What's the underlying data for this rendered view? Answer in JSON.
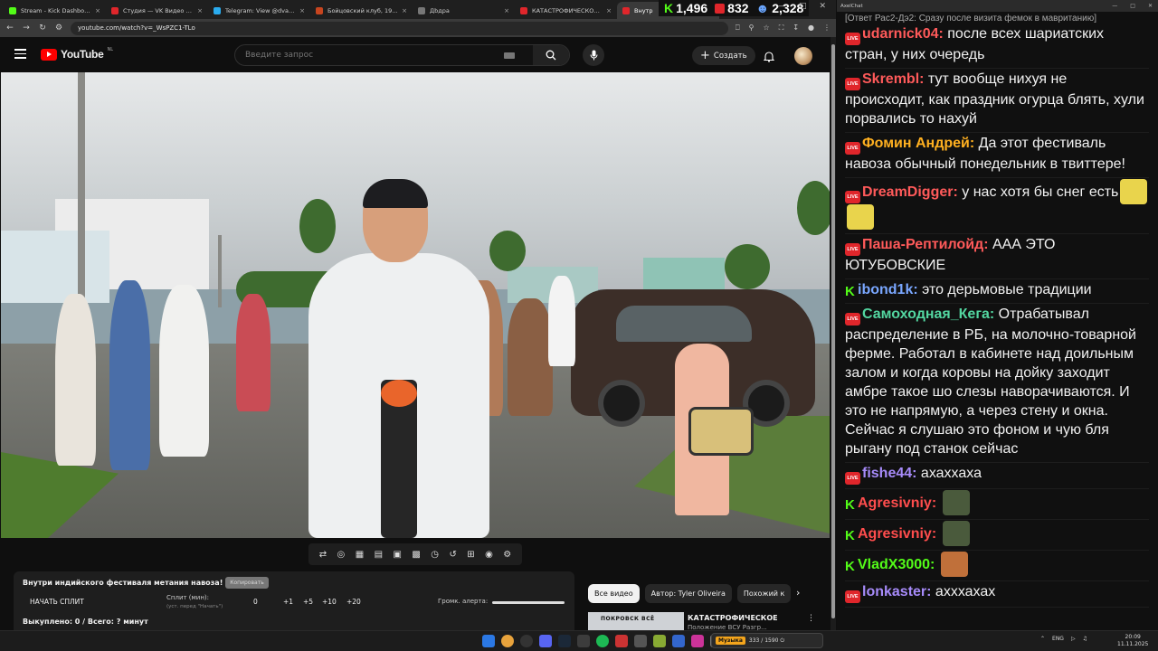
{
  "browser": {
    "tabs": [
      {
        "label": "Stream - Kick Dashboard",
        "color": "#53fc18"
      },
      {
        "label": "Студия — VK Видео Live",
        "color": "#e0262b"
      },
      {
        "label": "Telegram: View @dvachannel",
        "color": "#2aabee"
      },
      {
        "label": "Бойцовский клуб, 1999 — с",
        "color": "#c8451f"
      },
      {
        "label": "Дbдра",
        "color": "#777777"
      },
      {
        "label": "КАТАСТРОФИЧЕСКОЕ Пора",
        "color": "#e0262b"
      },
      {
        "label": "Внутр",
        "color": "#e0262b"
      }
    ],
    "url": "youtube.com/watch?v=_WsPZC1-TLo",
    "stats": {
      "kick": "1,496",
      "vk": "832",
      "total": "2,328"
    }
  },
  "youtube": {
    "logo_text": "YouTube",
    "region": "NL",
    "search_placeholder": "Введите запрос",
    "create_label": "Создать"
  },
  "split_panel": {
    "title": "Внутри индийского фестиваля метания навоза! 🇮🇳💩",
    "copy_label": "Копировать",
    "start_label": "НАЧАТЬ СПЛИТ",
    "split_label": "Сплит (мин):",
    "split_sub": "(уст. перед \"Начать\")",
    "split_value": "0",
    "increments": [
      "+1",
      "+5",
      "+10",
      "+20"
    ],
    "volume_label": "Громк. алерта:",
    "status": "Выкуплено: 0 / Всего: ? минут"
  },
  "chips": [
    "Все видео",
    "Автор: Tyler Oliveira",
    "Похожий к"
  ],
  "recommendation": {
    "thumb_text": "ПОКРОВСК ВСЁ",
    "title": "КАТАСТРОФИЧЕСКОЕ",
    "subtitle": "Положение ВСУ Разгр..."
  },
  "chat": {
    "window_title": "AxelChat",
    "messages": [
      {
        "platform": "vk",
        "user": "udarnick04:",
        "color": "#ff5a5a",
        "reply": "[Ответ Рас2-Дэ2: Сразу после визита фемок в мавританию]",
        "text": "после всех шариатских стран, у них очередь"
      },
      {
        "platform": "vk",
        "user": "Skrembl:",
        "color": "#ff5a5a",
        "text": "тут вообще нихуя не происходит, как праздник огурца блять, хули порвались то нахуй"
      },
      {
        "platform": "vk",
        "user": "Фомин Андрей:",
        "color": "#ffb020",
        "text": "Да этот фестиваль навоза обычный понедельник в твиттере!"
      },
      {
        "platform": "vk",
        "user": "DreamDigger:",
        "color": "#ff5a5a",
        "text": "у нас хотя бы снег есть",
        "emotes": 2
      },
      {
        "platform": "vk",
        "user": "Паша-Рептилойд:",
        "color": "#ff5a5a",
        "text": "ААА ЭТО ЮТУБОВСКИЕ"
      },
      {
        "platform": "kick",
        "user": "ibond1k:",
        "color": "#7aa7ff",
        "text": "это дерьмовые традиции"
      },
      {
        "platform": "vk",
        "user": "Самоходная_Кега:",
        "color": "#53d6a0",
        "text": "Отрабатывал распределение в РБ, на молочно-товарной ферме. Работал в кабинете над доильным залом и когда коровы на дойку заходит амбре такое шо слезы наворачиваются. И это не напрямую, а через стену и окна. Сейчас я слушаю это фоном и чую бля рыгану под станок сейчас"
      },
      {
        "platform": "vk",
        "user": "fishe44:",
        "color": "#a78bfa",
        "text": "ахаххаха"
      },
      {
        "platform": "kick",
        "user": "Agresivniy:",
        "color": "#ff4d4d",
        "text": "",
        "emotes": 1
      },
      {
        "platform": "kick",
        "user": "Agresivniy:",
        "color": "#ff4d4d",
        "text": "",
        "emotes": 1
      },
      {
        "platform": "kick",
        "user": "VladX3000:",
        "color": "#53fc18",
        "text": "",
        "emotes": 1
      },
      {
        "platform": "vk",
        "user": "lonkaster:",
        "color": "#a78bfa",
        "text": "ахххахах"
      }
    ]
  },
  "taskbar": {
    "music_label": "Музыка",
    "music_progress": "333 / 1590 ⏻",
    "lang": "ENG",
    "time": "20:09",
    "date": "11.11.2025"
  }
}
